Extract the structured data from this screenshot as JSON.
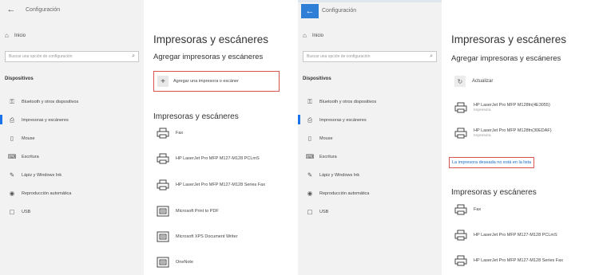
{
  "left": {
    "titlebar": {
      "back_glyph": "←",
      "title": "Configuración"
    },
    "home": {
      "icon": "home-icon",
      "label": "Inicio"
    },
    "search": {
      "placeholder": "Buscar una opción de configuración"
    },
    "section": "Dispositivos",
    "nav": [
      {
        "icon": "bluetooth-icon",
        "label": "Bluetooth y otros dispositivos",
        "active": false
      },
      {
        "icon": "printer-icon",
        "label": "Impresoras y escáneres",
        "active": true
      },
      {
        "icon": "mouse-icon",
        "label": "Mouse",
        "active": false
      },
      {
        "icon": "keyboard-icon",
        "label": "Escritura",
        "active": false
      },
      {
        "icon": "pen-icon",
        "label": "Lápiz y Windows Ink",
        "active": false
      },
      {
        "icon": "autoplay-icon",
        "label": "Reproducción automática",
        "active": false
      },
      {
        "icon": "usb-icon",
        "label": "USB",
        "active": false
      }
    ],
    "content": {
      "title": "Impresoras y escáneres",
      "add_heading": "Agregar impresoras y escáneres",
      "add_button": "Agregar una impresora o escáner",
      "list_heading": "Impresoras y escáneres",
      "printers": [
        {
          "name": "Fax",
          "kind": "printer"
        },
        {
          "name": "HP LaserJet Pro MFP M127-M128 PCLmS",
          "kind": "printer"
        },
        {
          "name": "HP LaserJet Pro MFP M127-M128 Series Fax",
          "kind": "printer"
        },
        {
          "name": "Microsoft Print to PDF",
          "kind": "document"
        },
        {
          "name": "Microsoft XPS Document Writer",
          "kind": "document"
        },
        {
          "name": "OneNote",
          "kind": "document"
        }
      ]
    }
  },
  "right": {
    "titlebar": {
      "back_glyph": "←",
      "title": "Configuración"
    },
    "home": {
      "icon": "home-icon",
      "label": "Inicio"
    },
    "search": {
      "placeholder": "Buscar una opción de configuración"
    },
    "section": "Dispositivos",
    "nav": [
      {
        "icon": "bluetooth-icon",
        "label": "Bluetooth y otros dispositivos",
        "active": false
      },
      {
        "icon": "printer-icon",
        "label": "Impresoras y escáneres",
        "active": true
      },
      {
        "icon": "mouse-icon",
        "label": "Mouse",
        "active": false
      },
      {
        "icon": "keyboard-icon",
        "label": "Escritura",
        "active": false
      },
      {
        "icon": "pen-icon",
        "label": "Lápiz y Windows Ink",
        "active": false
      },
      {
        "icon": "autoplay-icon",
        "label": "Reproducción automática",
        "active": false
      },
      {
        "icon": "usb-icon",
        "label": "USB",
        "active": false
      }
    ],
    "content": {
      "title": "Impresoras y escáneres",
      "add_heading": "Agregar impresoras y escáneres",
      "refresh": "Actualizar",
      "found": [
        {
          "name": "HP LaserJet Pro MFP M128fn(4E3055)",
          "sub": "Impresora"
        },
        {
          "name": "HP LaserJet Pro MFP M128fn(30EDAF)",
          "sub": "Impresora"
        }
      ],
      "missing_link": "La impresora deseada no está en la lista",
      "list_heading": "Impresoras y escáneres",
      "printers": [
        {
          "name": "Fax",
          "kind": "printer"
        },
        {
          "name": "HP LaserJet Pro MFP M127-M128 PCLmS",
          "kind": "printer"
        },
        {
          "name": "HP LaserJet Pro MFP M127-M128 Series Fax",
          "kind": "printer"
        }
      ]
    }
  },
  "colors": {
    "accent": "#1a73e8",
    "highlight": "#d9534f",
    "link": "#1a6fc4",
    "sidebar_bg": "#f2f2f2"
  }
}
